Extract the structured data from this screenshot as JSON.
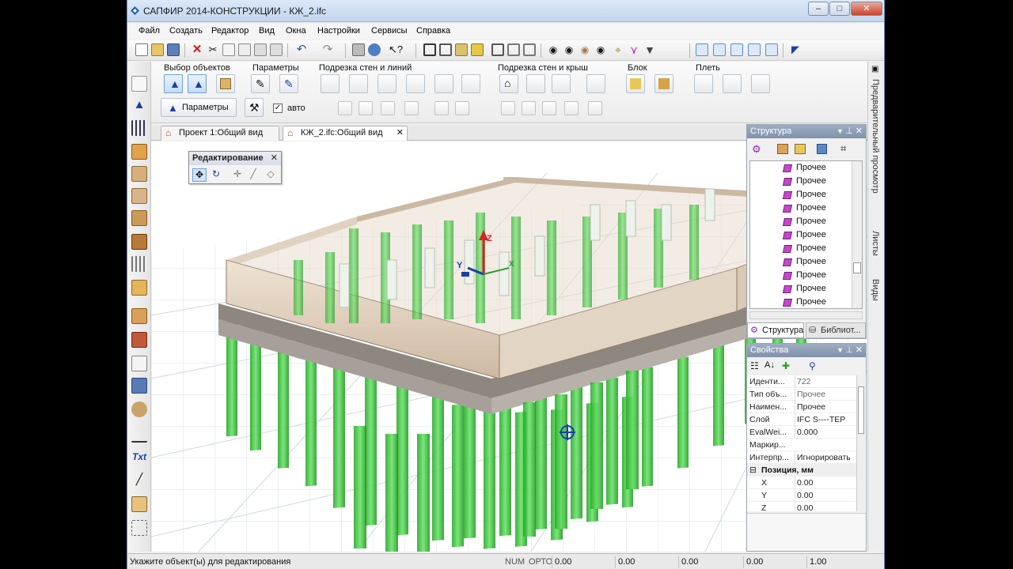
{
  "window": {
    "title": "САПФИР 2014-КОНСТРУКЦИИ - КЖ_2.ifc",
    "caption_buttons": [
      "–",
      "□",
      "✕"
    ]
  },
  "menu": [
    "Файл",
    "Создать",
    "Редактор",
    "Вид",
    "Окна",
    "Настройки",
    "Сервисы",
    "Справка"
  ],
  "ribbon": {
    "groups": {
      "select": "Выбор объектов",
      "params": "Параметры",
      "walls_lines": "Подрезка стен и линий",
      "walls_roofs": "Подрезка стен и крыш",
      "block": "Блок",
      "slab": "Плеть"
    },
    "params_button": "Параметры",
    "auto_label": "авто",
    "auto_checked": true
  },
  "tabs": [
    {
      "label": "Проект 1:Общий вид",
      "active": false
    },
    {
      "label": "КЖ_2.ifc:Общий вид",
      "active": true
    }
  ],
  "editing_panel": {
    "title": "Редактирование"
  },
  "axes": {
    "x": "X",
    "y": "Y",
    "z": "Z"
  },
  "structure_panel": {
    "title": "Структура",
    "items": [
      "Прочее",
      "Прочее",
      "Прочее",
      "Прочее",
      "Прочее",
      "Прочее",
      "Прочее",
      "Прочее",
      "Прочее",
      "Прочее",
      "Прочее"
    ],
    "bottom_tabs": [
      "Структура",
      "Библиот..."
    ]
  },
  "properties_panel": {
    "title": "Свойства",
    "rows": [
      {
        "name": "Иденти...",
        "value": "722"
      },
      {
        "name": "Тип объ...",
        "value": "Прочее"
      },
      {
        "name": "Наимен...",
        "value": "Прочее"
      },
      {
        "name": "Слой",
        "value": "IFC S----TEP"
      },
      {
        "name": "EvalWei...",
        "value": "0.000"
      },
      {
        "name": "Маркир...",
        "value": ""
      },
      {
        "name": "Интерпр...",
        "value": "Игнорировать"
      }
    ],
    "group": "Позиция, мм",
    "position": [
      {
        "name": "X",
        "value": "0.00"
      },
      {
        "name": "Y",
        "value": "0.00"
      },
      {
        "name": "Z",
        "value": "0.00"
      }
    ]
  },
  "right_strip": [
    "Предварительный просмотр",
    "Листы",
    "Виды"
  ],
  "status": {
    "message": "Укажите объект(ы) для редактирования",
    "num": "NUM",
    "orto": "ОРТО",
    "fields": [
      "0.00",
      "0.00",
      "0.00",
      "0.00",
      "1.00"
    ]
  },
  "colors": {
    "accent": "#3b6fb6",
    "pile_green": "#2ecc2e",
    "wall_beige": "#e8d8c4",
    "slab_gray": "#a09a93"
  }
}
